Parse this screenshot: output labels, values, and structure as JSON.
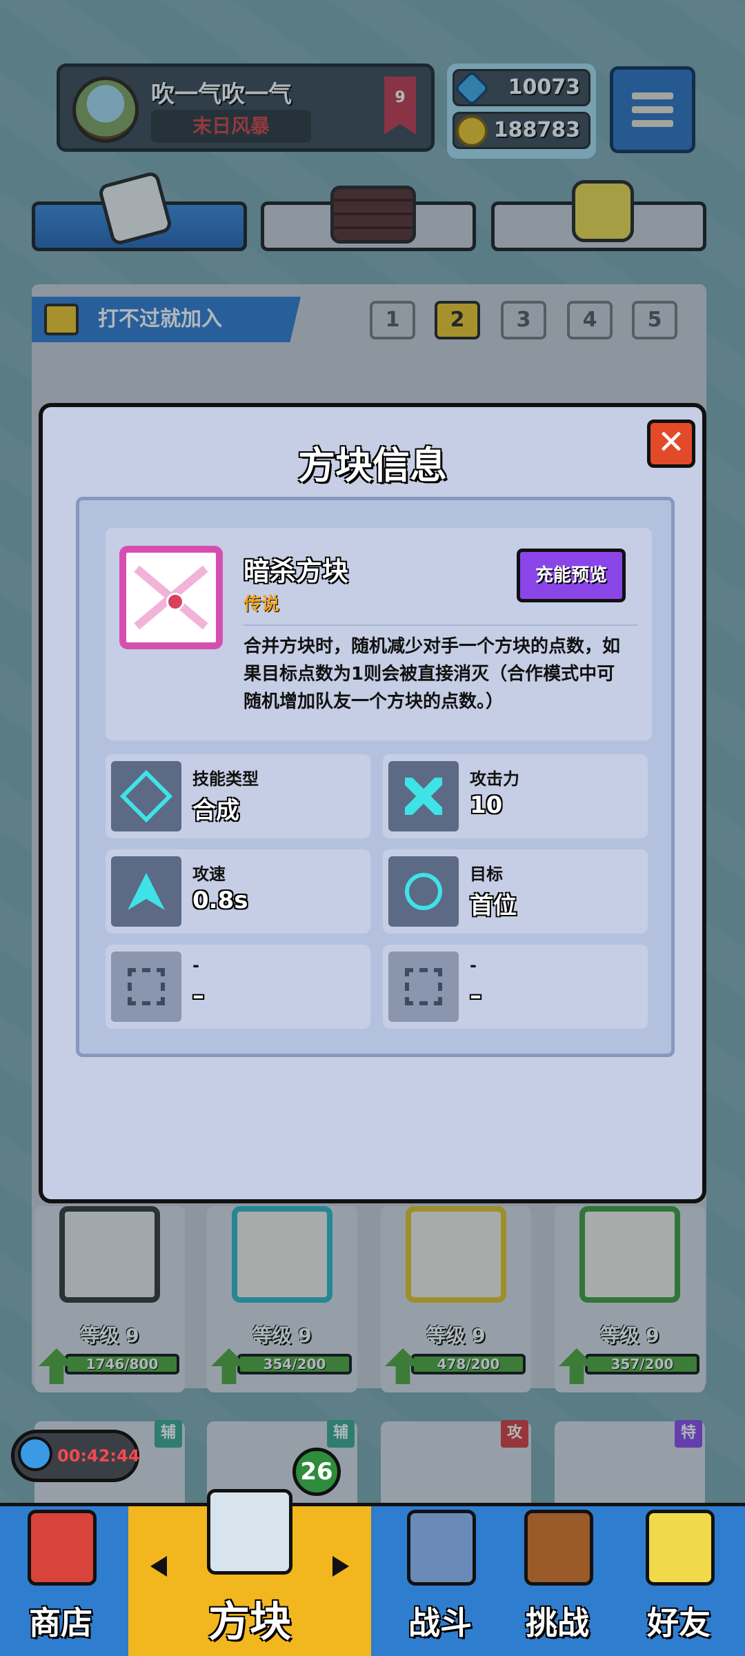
{
  "profile": {
    "name": "吹一气吹一气",
    "title_tag": "末日风暴",
    "rank": "9"
  },
  "currency": {
    "gems": "10073",
    "coins": "188783"
  },
  "tabs": [
    {
      "icon": "dice-icon"
    },
    {
      "icon": "grid-board-icon"
    },
    {
      "icon": "smile-block-icon"
    }
  ],
  "deck": {
    "name": "打不过就加入",
    "pages": [
      "1",
      "2",
      "3",
      "4",
      "5"
    ],
    "active_page": "2"
  },
  "modal": {
    "title": "方块信息",
    "close_label": "✕",
    "block_name": "暗杀方块",
    "rarity": "传说",
    "preview_button": "充能预览",
    "description": "合并方块时，随机减少对手一个方块的点数，如果目标点数为1则会被直接消灭（合作模式中可随机增加队友一个方块的点数。）",
    "stats": [
      {
        "label": "技能类型",
        "value": "合成",
        "icon": "skill-type-icon"
      },
      {
        "label": "攻击力",
        "value": "10",
        "icon": "crossed-swords-icon"
      },
      {
        "label": "攻速",
        "value": "0.8s",
        "icon": "attack-speed-icon"
      },
      {
        "label": "目标",
        "value": "首位",
        "icon": "target-icon"
      },
      {
        "label": "-",
        "value": "–",
        "icon": "empty-slot-icon"
      },
      {
        "label": "-",
        "value": "–",
        "icon": "empty-slot-icon"
      }
    ]
  },
  "cards": [
    {
      "level": "等级 9",
      "progress": "1746/800"
    },
    {
      "level": "等级 9",
      "progress": "354/200"
    },
    {
      "level": "等级 9",
      "progress": "478/200"
    },
    {
      "level": "等级 9",
      "progress": "357/200"
    }
  ],
  "card_tags": [
    "辅",
    "辅",
    "攻",
    "特"
  ],
  "timer": "00:42:44",
  "block_count": "26",
  "nav": {
    "shop": "商店",
    "blocks": "方块",
    "battle": "战斗",
    "challenge": "挑战",
    "friends": "好友"
  },
  "colors": {
    "accent_blue": "#2f7dce",
    "active_tab": "#f2b61e",
    "legendary": "#f2a11e",
    "preview_purple": "#8a45e8"
  }
}
